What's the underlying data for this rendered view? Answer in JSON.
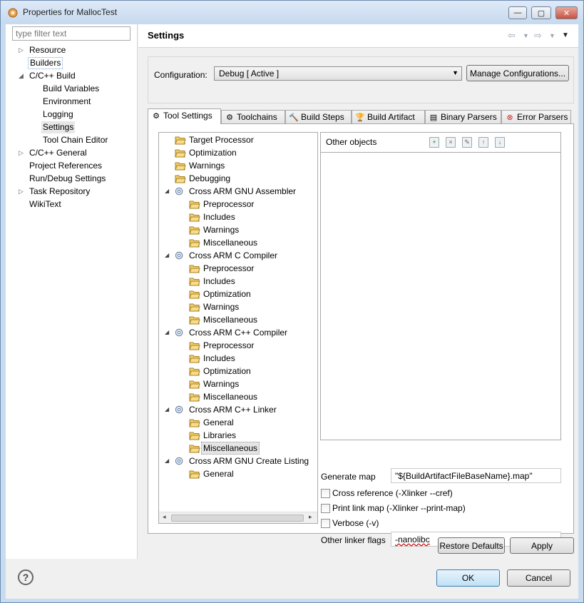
{
  "window": {
    "title": "Properties for MallocTest",
    "controls": [
      "minimize",
      "maximize",
      "close"
    ]
  },
  "filter": {
    "placeholder": "type filter text"
  },
  "nav": {
    "items": [
      {
        "label": "Resource",
        "twisty": "▷"
      },
      {
        "label": "Builders",
        "twisty": ""
      },
      {
        "label": "C/C++ Build",
        "twisty": "◢"
      },
      {
        "label": "Build Variables",
        "twisty": ""
      },
      {
        "label": "Environment",
        "twisty": ""
      },
      {
        "label": "Logging",
        "twisty": ""
      },
      {
        "label": "Settings",
        "twisty": ""
      },
      {
        "label": "Tool Chain Editor",
        "twisty": ""
      },
      {
        "label": "C/C++ General",
        "twisty": "▷"
      },
      {
        "label": "Project References",
        "twisty": ""
      },
      {
        "label": "Run/Debug Settings",
        "twisty": ""
      },
      {
        "label": "Task Repository",
        "twisty": "▷"
      },
      {
        "label": "WikiText",
        "twisty": ""
      }
    ]
  },
  "header": {
    "title": "Settings"
  },
  "config": {
    "label": "Configuration:",
    "value": "Debug  [ Active ]",
    "manage_button": "Manage Configurations..."
  },
  "tabs": [
    {
      "label": "Tool Settings",
      "icon": "tool-settings-icon",
      "active": true
    },
    {
      "label": "Toolchains",
      "icon": "toolchains-icon"
    },
    {
      "label": "Build Steps",
      "icon": "build-steps-icon"
    },
    {
      "label": "Build Artifact",
      "icon": "build-artifact-icon"
    },
    {
      "label": "Binary Parsers",
      "icon": "binary-parsers-icon"
    },
    {
      "label": "Error Parsers",
      "icon": "error-parsers-icon"
    }
  ],
  "tool_tree": [
    "Target Processor",
    "Optimization",
    "Warnings",
    "Debugging",
    "Cross ARM GNU Assembler",
    "Preprocessor",
    "Includes",
    "Warnings",
    "Miscellaneous",
    "Cross ARM C Compiler",
    "Preprocessor",
    "Includes",
    "Optimization",
    "Warnings",
    "Miscellaneous",
    "Cross ARM C++ Compiler",
    "Preprocessor",
    "Includes",
    "Optimization",
    "Warnings",
    "Miscellaneous",
    "Cross ARM C++ Linker",
    "General",
    "Libraries",
    "Miscellaneous",
    "Cross ARM GNU Create Listing",
    "General"
  ],
  "objects": {
    "title": "Other objects",
    "tools": [
      "add-icon",
      "delete-icon",
      "edit-icon",
      "move-up-icon",
      "move-down-icon"
    ]
  },
  "linker_misc": {
    "generate_map_label": "Generate map",
    "generate_map_value": "\"${BuildArtifactFileBaseName}.map\"",
    "cross_reference": "Cross reference (-Xlinker --cref)",
    "print_link_map": "Print link map (-Xlinker --print-map)",
    "verbose": "Verbose (-v)",
    "other_flags_label": "Other linker flags",
    "other_flags_value": "-nanolibc"
  },
  "buttons": {
    "restore_defaults": "Restore Defaults",
    "apply": "Apply",
    "ok": "OK",
    "cancel": "Cancel",
    "help": "?"
  }
}
